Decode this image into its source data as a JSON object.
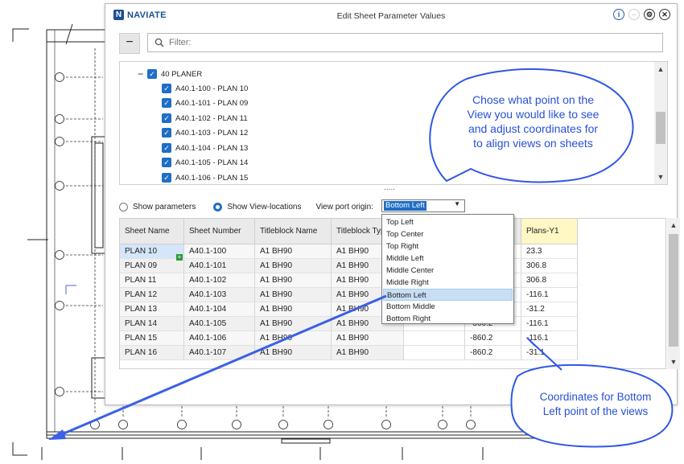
{
  "dialog": {
    "brand": "NAVIATE",
    "title": "Edit Sheet Parameter Values",
    "collapse_label": "−",
    "filter_placeholder": "Filter:"
  },
  "tree": {
    "root": {
      "label": "40 PLANER",
      "checked": true
    },
    "items": [
      {
        "label": "A40.1-100 - PLAN 10",
        "checked": true
      },
      {
        "label": "A40.1-101 - PLAN 09",
        "checked": true
      },
      {
        "label": "A40.1-102 - PLAN 11",
        "checked": true
      },
      {
        "label": "A40.1-103 - PLAN 12",
        "checked": true
      },
      {
        "label": "A40.1-104 - PLAN 13",
        "checked": true
      },
      {
        "label": "A40.1-105 - PLAN 14",
        "checked": true
      },
      {
        "label": "A40.1-106 - PLAN 15",
        "checked": true
      }
    ]
  },
  "options": {
    "show_parameters": "Show parameters",
    "show_view_locations": "Show View-locations",
    "selected": "Show View-locations",
    "viewport_origin_label": "View port origin:",
    "viewport_origin_value": "Bottom Left",
    "dots": "....."
  },
  "dropdown_options": [
    "Top Left",
    "Top Center",
    "Top Right",
    "Middle Left",
    "Middle Center",
    "Middle Right",
    "Bottom Left",
    "Bottom Middle",
    "Bottom Right"
  ],
  "dropdown_selected": "Bottom Left",
  "table": {
    "columns": [
      "Sheet Name",
      "Sheet Number",
      "Titleblock Name",
      "Titleblock Typ",
      "",
      "",
      "Plans-Y1"
    ],
    "rows": [
      [
        "PLAN 10",
        "A40.1-100",
        "A1 BH90",
        "A1 BH90",
        "",
        "",
        "23.3"
      ],
      [
        "PLAN 09",
        "A40.1-101",
        "A1 BH90",
        "A1 BH90",
        "",
        "",
        "306.8"
      ],
      [
        "PLAN 11",
        "A40.1-102",
        "A1 BH90",
        "A1 BH90",
        "",
        "",
        "306.8"
      ],
      [
        "PLAN 12",
        "A40.1-103",
        "A1 BH90",
        "A1 BH90",
        "",
        "",
        "-116.1"
      ],
      [
        "PLAN 13",
        "A40.1-104",
        "A1 BH90",
        "A1 BH90",
        "",
        "",
        "-31.2"
      ],
      [
        "PLAN 14",
        "A40.1-105",
        "A1 BH90",
        "A1 BH90",
        "",
        "-860.2",
        "-116.1"
      ],
      [
        "PLAN 15",
        "A40.1-106",
        "A1 BH90",
        "A1 BH90",
        "",
        "-860.2",
        "-116.1"
      ],
      [
        "PLAN 16",
        "A40.1-107",
        "A1 BH90",
        "A1 BH90",
        "",
        "-860.2",
        "-31.1"
      ]
    ]
  },
  "callouts": {
    "top": "Chose what point on the View you would like to see and adjust coordinates for to align views on sheets",
    "bottom": "Coordinates for Bottom Left point of the views"
  },
  "colors": {
    "accent": "#1f6ec5",
    "callout_border": "#2f57e6",
    "callout_text": "#2850d8",
    "header_highlight": "#fff8c4"
  }
}
